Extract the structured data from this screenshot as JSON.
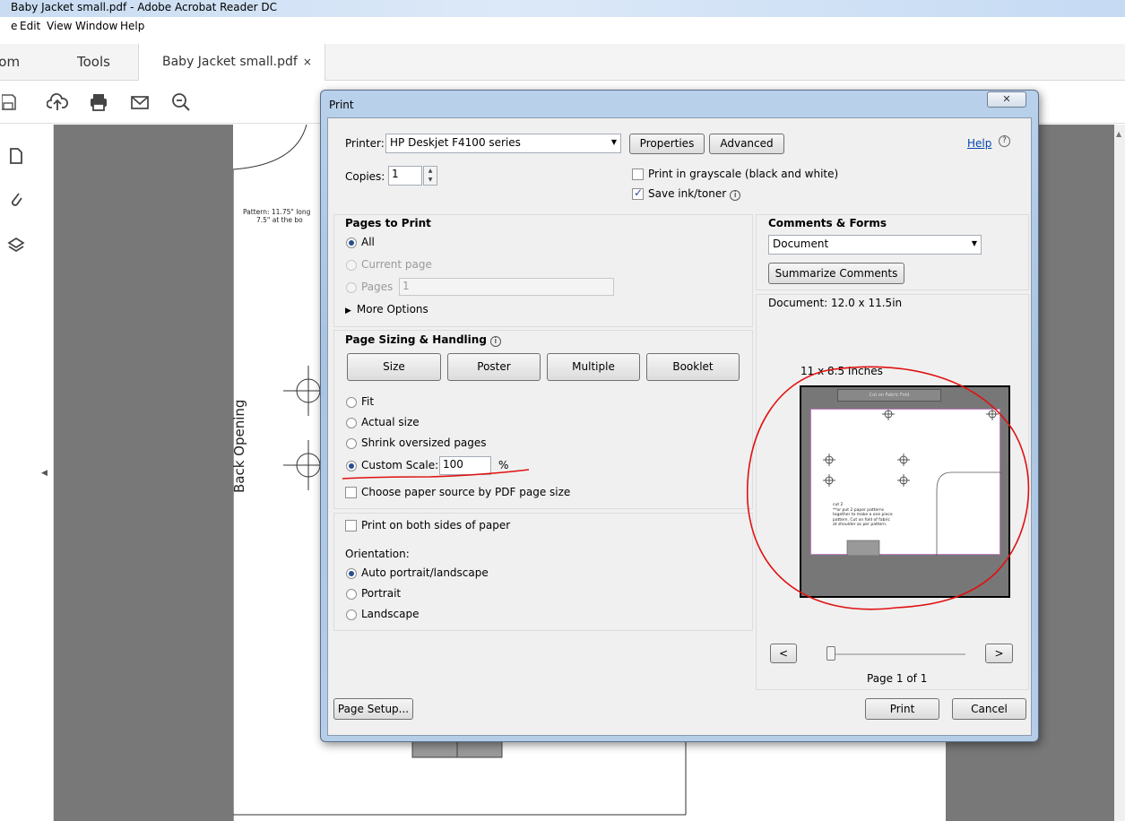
{
  "window": {
    "title": "Baby Jacket small.pdf - Adobe Acrobat Reader DC"
  },
  "menu": [
    "e",
    "Edit",
    "View",
    "Window",
    "Help"
  ],
  "tabs": {
    "home": "Home",
    "tools": "Tools",
    "document": "Baby Jacket small.pdf",
    "close": "×"
  },
  "toolbar_icons": [
    "save-icon",
    "cloud-upload-icon",
    "print-icon",
    "email-icon",
    "zoom-out-icon"
  ],
  "rail_icons": [
    "pages-icon",
    "attachment-icon",
    "layers-icon"
  ],
  "document": {
    "back_opening": "Back Opening",
    "pattern_note_1": "Pattern: 11.75\" long",
    "pattern_note_2": "7.5\" at the bo"
  },
  "dialog": {
    "title": "Print",
    "close": "✕",
    "printer_label": "Printer:",
    "printer_value": "HP Deskjet F4100 series",
    "properties": "Properties",
    "advanced": "Advanced",
    "help": "Help",
    "copies_label": "Copies:",
    "copies_value": "1",
    "grayscale": "Print in grayscale (black and white)",
    "grayscale_checked": false,
    "save_ink": "Save ink/toner",
    "save_ink_checked": true,
    "pages_to_print": {
      "heading": "Pages to Print",
      "all": "All",
      "current": "Current page",
      "pages": "Pages",
      "pages_value": "1",
      "more": "More Options",
      "selected": "All"
    },
    "sizing": {
      "heading": "Page Sizing & Handling",
      "buttons": [
        "Size",
        "Poster",
        "Multiple",
        "Booklet"
      ],
      "fit": "Fit",
      "actual": "Actual size",
      "shrink": "Shrink oversized pages",
      "custom": "Custom Scale:",
      "custom_value": "100",
      "percent": "%",
      "paper_source": "Choose paper source by PDF page size",
      "selected": "Custom Scale"
    },
    "duplex": "Print on both sides of paper",
    "orientation": {
      "heading": "Orientation:",
      "auto": "Auto portrait/landscape",
      "portrait": "Portrait",
      "landscape": "Landscape",
      "selected": "Auto portrait/landscape"
    },
    "comments_forms": {
      "heading": "Comments & Forms",
      "value": "Document",
      "summarize": "Summarize Comments"
    },
    "preview": {
      "doc_size": "Document: 12.0 x 11.5in",
      "paper_size": "11 x 8.5 Inches",
      "page": "Page 1 of 1",
      "prev": "<",
      "next": ">",
      "page_top_label": "Cut on Fabric Fold",
      "page_note_title": "cut 2",
      "page_note_lines": [
        "**or put 2 paper patterns",
        "together to make a one piece",
        "pattern. Cut on fold of fabric",
        "at shoulder as per pattern."
      ]
    },
    "page_setup": "Page Setup...",
    "print": "Print",
    "cancel": "Cancel"
  },
  "annotation_color": "#e01010"
}
